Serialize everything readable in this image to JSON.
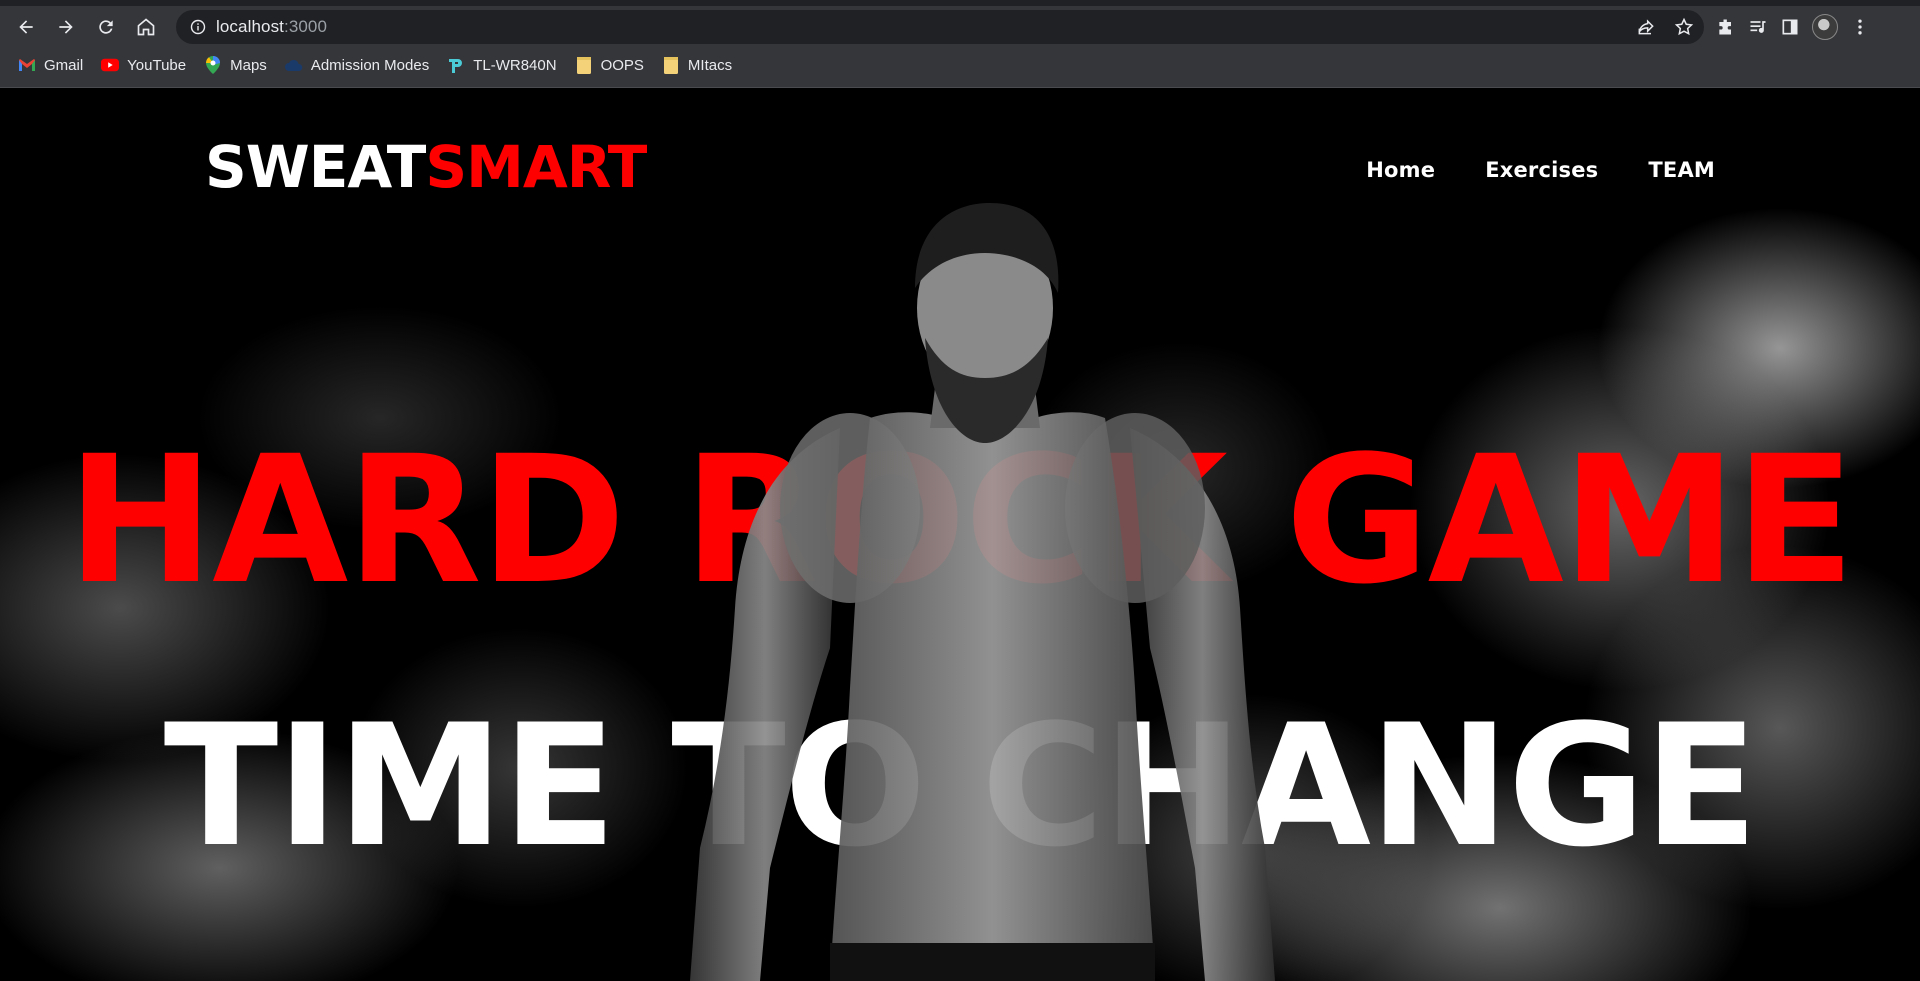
{
  "browser": {
    "url_host": "localhost",
    "url_port": ":3000",
    "bookmarks": [
      {
        "label": "Gmail",
        "icon": "gmail-icon",
        "color": "#ea4335"
      },
      {
        "label": "YouTube",
        "icon": "youtube-icon",
        "color": "#ff0000"
      },
      {
        "label": "Maps",
        "icon": "maps-icon",
        "color": "#34a853"
      },
      {
        "label": "Admission Modes",
        "icon": "cloud-icon",
        "color": "#1a2a4a"
      },
      {
        "label": "TL-WR840N",
        "icon": "tplink-icon",
        "color": "#4acbd6"
      },
      {
        "label": "OOPS",
        "icon": "folder-icon",
        "color": "#f3d27a"
      },
      {
        "label": "MItacs",
        "icon": "folder-icon",
        "color": "#f3d27a"
      }
    ]
  },
  "site": {
    "logo_part1": "SWEAT",
    "logo_part2": "SMART",
    "nav": [
      {
        "label": "Home"
      },
      {
        "label": "Exercises"
      },
      {
        "label": "TEAM"
      }
    ],
    "headline_line1": "HARD ROCK GAME",
    "headline_line2": "TIME TO CHANGE",
    "colors": {
      "accent": "#ff0000",
      "text": "#ffffff",
      "background": "#000000"
    }
  }
}
